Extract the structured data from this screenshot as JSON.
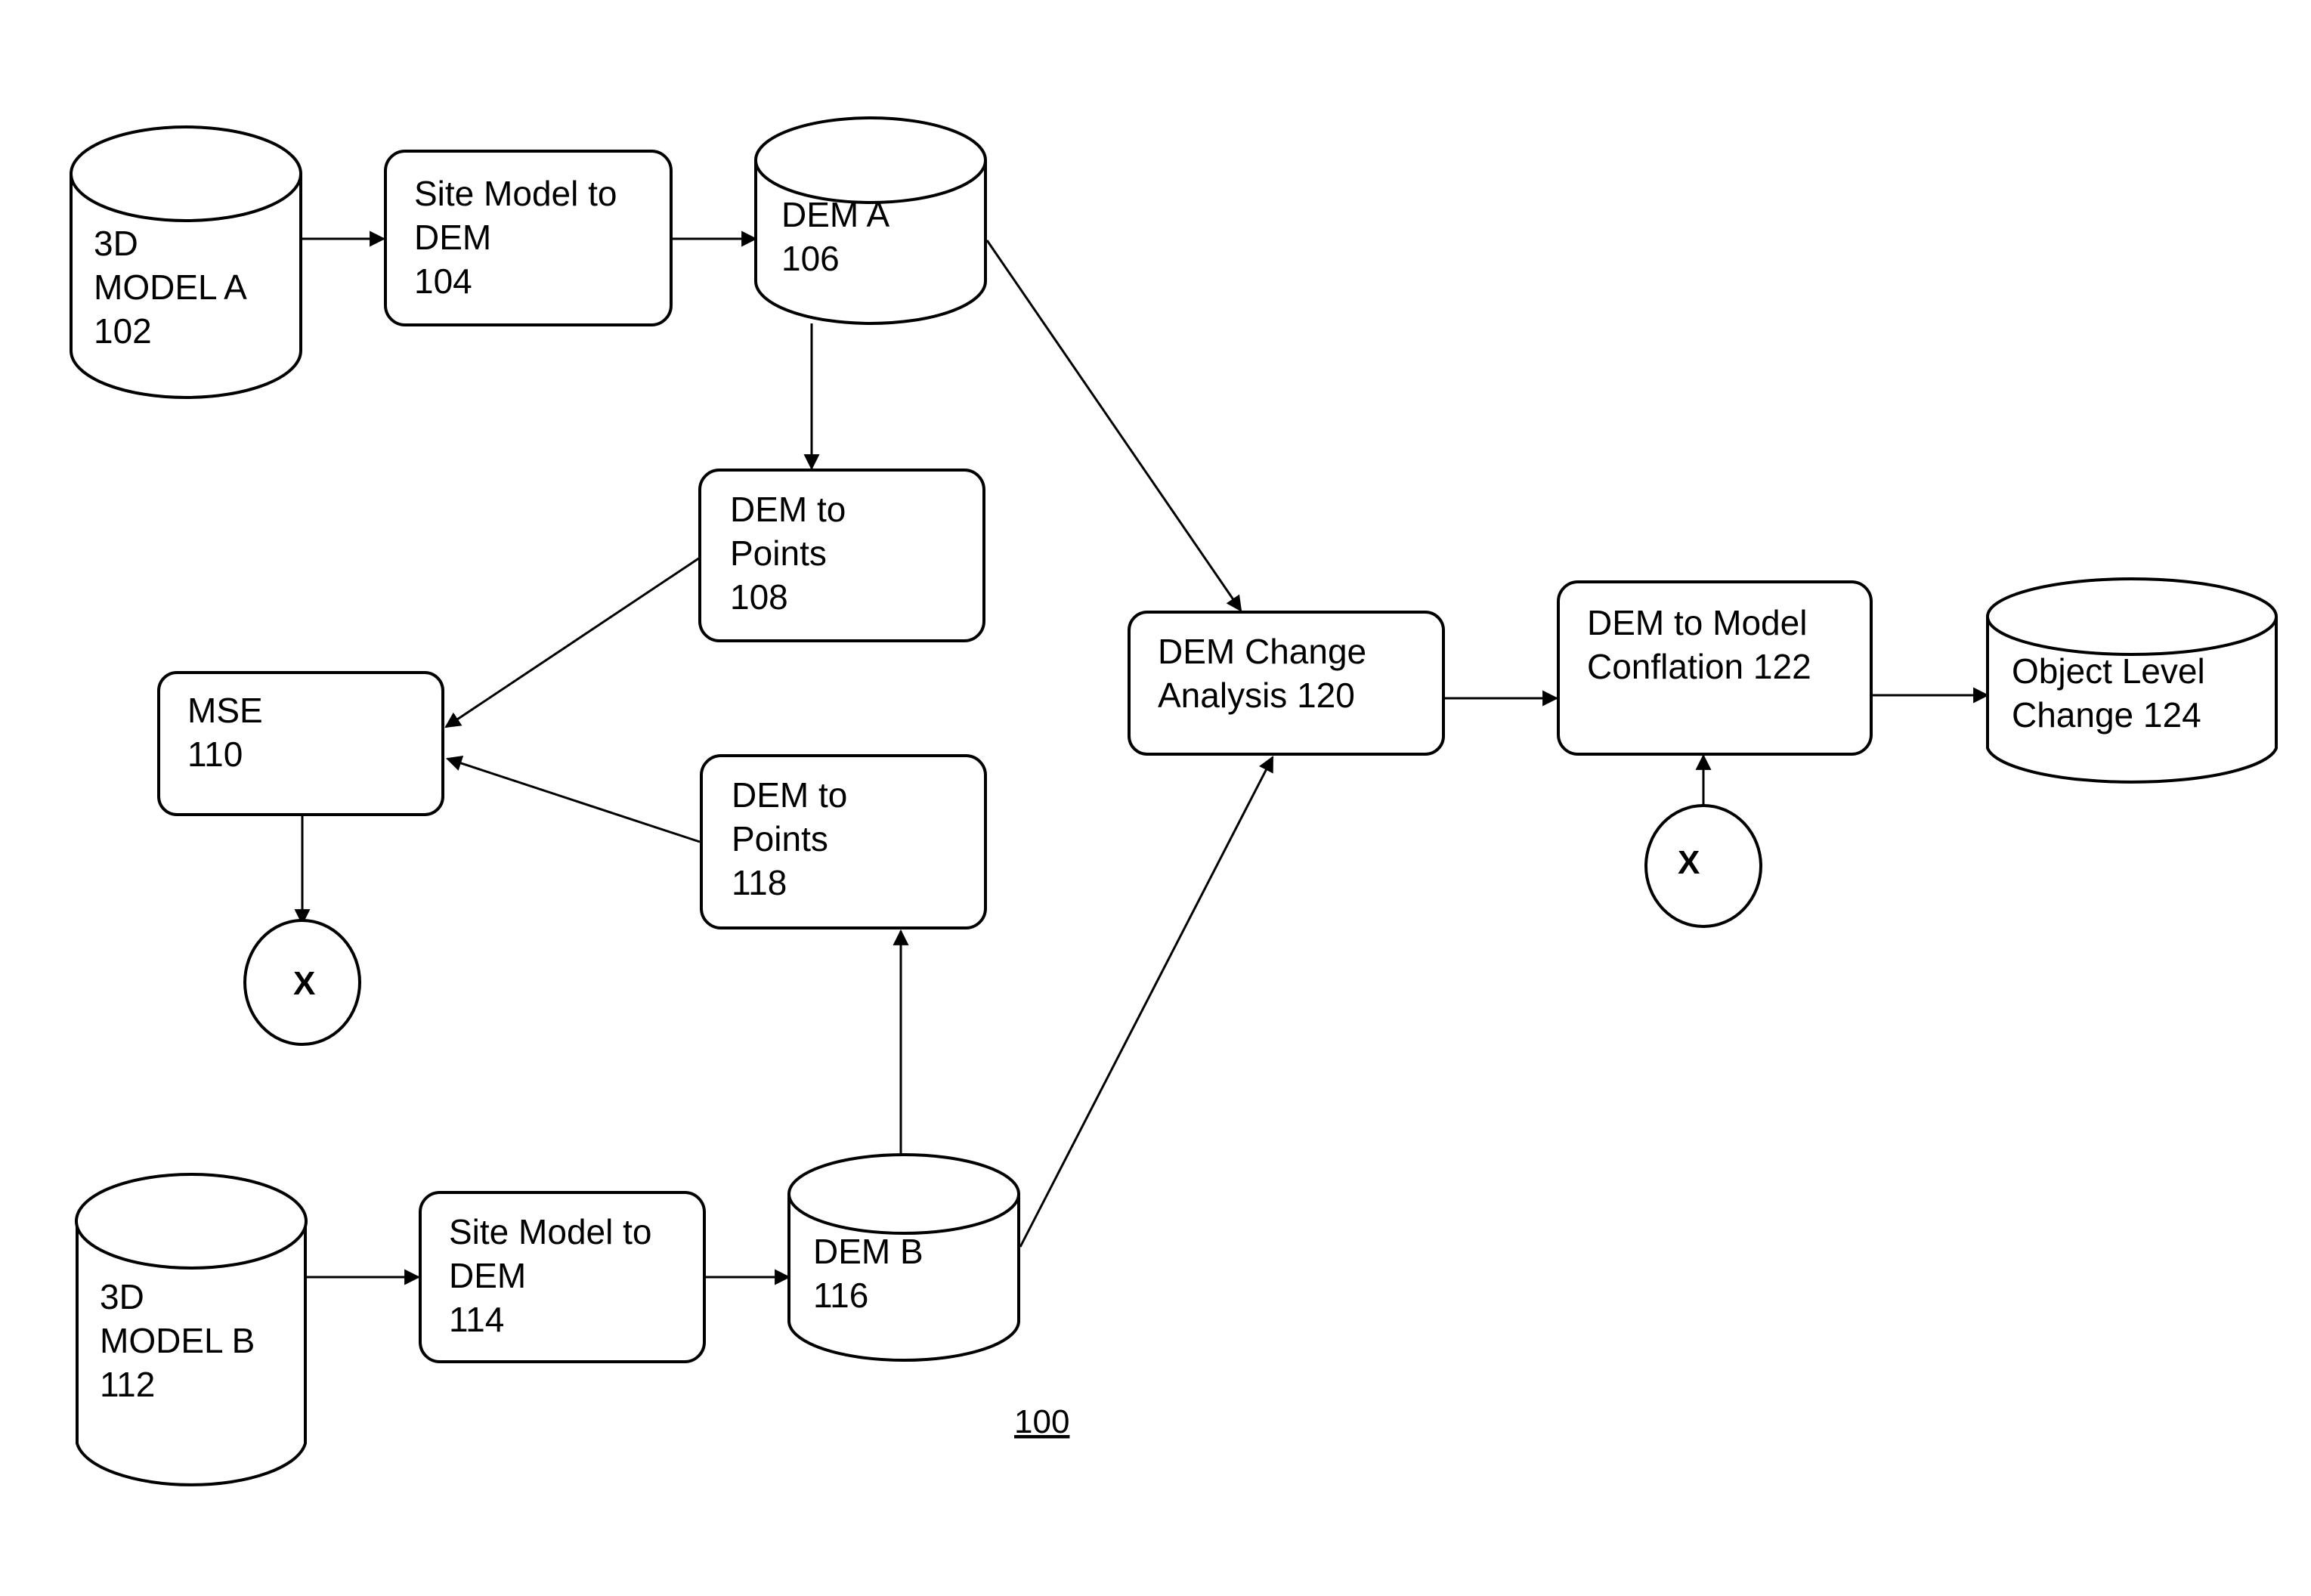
{
  "figure_label": "100",
  "nodes": {
    "n102": {
      "kind": "cylinder",
      "lines": [
        "3D",
        "MODEL A",
        "102"
      ]
    },
    "n104": {
      "kind": "box",
      "lines": [
        "Site Model to",
        "DEM",
        "104"
      ]
    },
    "n106": {
      "kind": "cylinder",
      "lines": [
        "DEM A",
        "106"
      ]
    },
    "n108": {
      "kind": "box",
      "lines": [
        "DEM to",
        "Points",
        "108"
      ]
    },
    "n110": {
      "kind": "box",
      "lines": [
        "MSE",
        "110"
      ]
    },
    "n112": {
      "kind": "cylinder",
      "lines": [
        "3D",
        "MODEL B",
        "112"
      ]
    },
    "n114": {
      "kind": "box",
      "lines": [
        "Site Model to",
        "DEM",
        "114"
      ]
    },
    "n116": {
      "kind": "cylinder",
      "lines": [
        "DEM B",
        "116"
      ]
    },
    "n118": {
      "kind": "box",
      "lines": [
        "DEM to",
        "Points",
        "118"
      ]
    },
    "n120": {
      "kind": "box",
      "lines": [
        "DEM Change",
        "Analysis 120"
      ]
    },
    "n122": {
      "kind": "box",
      "lines": [
        "DEM to Model",
        "Conflation 122"
      ]
    },
    "n124": {
      "kind": "cylinder",
      "lines": [
        "Object Level",
        "Change 124"
      ]
    },
    "xa": {
      "kind": "connector",
      "lines": [
        "X"
      ]
    },
    "xb": {
      "kind": "connector",
      "lines": [
        "X"
      ]
    }
  },
  "edges": [
    {
      "from": "n102",
      "to": "n104"
    },
    {
      "from": "n104",
      "to": "n106"
    },
    {
      "from": "n106",
      "to": "n108"
    },
    {
      "from": "n106",
      "to": "n120"
    },
    {
      "from": "n108",
      "to": "n110"
    },
    {
      "from": "n118",
      "to": "n110"
    },
    {
      "from": "n110",
      "to": "xa"
    },
    {
      "from": "n112",
      "to": "n114"
    },
    {
      "from": "n114",
      "to": "n116"
    },
    {
      "from": "n116",
      "to": "n118"
    },
    {
      "from": "n116",
      "to": "n120"
    },
    {
      "from": "n120",
      "to": "n122"
    },
    {
      "from": "xb",
      "to": "n122"
    },
    {
      "from": "n122",
      "to": "n124"
    }
  ]
}
